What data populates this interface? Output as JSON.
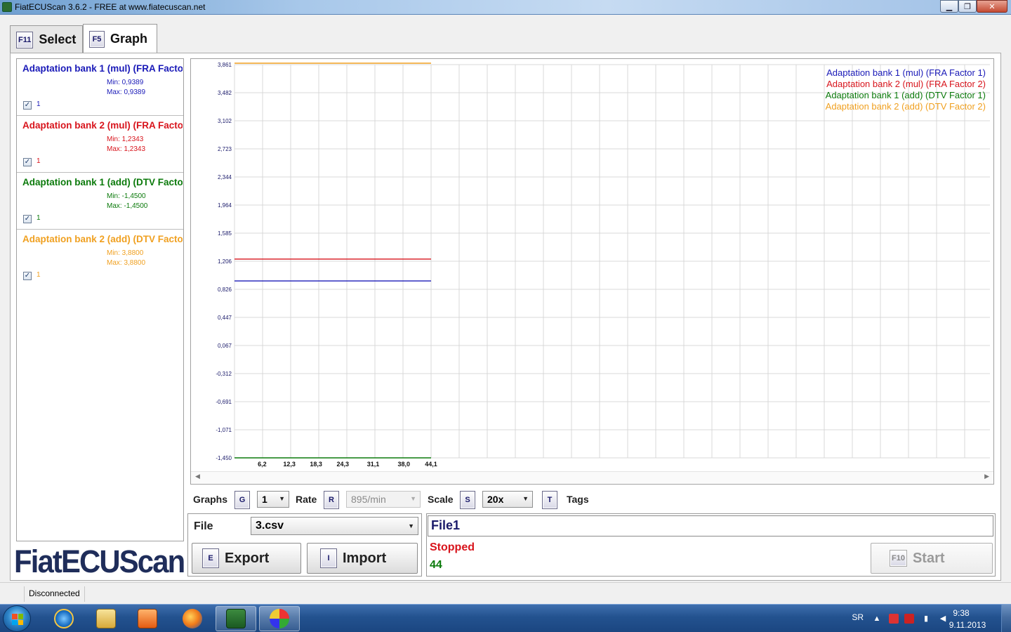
{
  "window": {
    "title": "FiatECUScan 3.6.2 - FREE at www.fiatecuscan.net",
    "minimize": "▁",
    "maximize": "❐",
    "close": "✕"
  },
  "tabs": [
    {
      "key": "F11",
      "label": "Select",
      "active": false
    },
    {
      "key": "F5",
      "label": "Graph",
      "active": true
    }
  ],
  "sensors": [
    {
      "name": "Adaptation bank 1 (mul) (FRA Factor 1)",
      "min": "Min: 0,9389",
      "max": "Max: 0,9389",
      "check_label": "1",
      "checked": true,
      "color": "#1a1ab8"
    },
    {
      "name": "Adaptation bank 2 (mul) (FRA Factor 2)",
      "min": "Min: 1,2343",
      "max": "Max: 1,2343",
      "check_label": "1",
      "checked": true,
      "color": "#d8141c"
    },
    {
      "name": "Adaptation bank 1 (add) (DTV Factor 1)",
      "min": "Min: -1,4500",
      "max": "Max: -1,4500",
      "check_label": "1",
      "checked": true,
      "color": "#0b7a0b"
    },
    {
      "name": "Adaptation bank 2 (add) (DTV Factor 2)",
      "min": "Min: 3,8800",
      "max": "Max: 3,8800",
      "check_label": "1",
      "checked": true,
      "color": "#f0a020"
    }
  ],
  "logo": "FiatECUScan",
  "chart_data": {
    "type": "line",
    "y_ticks": [
      "3,861",
      "3,482",
      "3,102",
      "2,723",
      "2,344",
      "1,964",
      "1,585",
      "1,206",
      "0,826",
      "0,447",
      "0,067",
      "-0,312",
      "-0,691",
      "-1,071",
      "-1,450"
    ],
    "x_ticks": [
      "6,2",
      "12,3",
      "18,3",
      "24,3",
      "31,1",
      "38,0",
      "44,1"
    ],
    "ylim": [
      -1.45,
      3.861
    ],
    "xlim": [
      0,
      44.1
    ],
    "grid": true,
    "legend_position": "top-right",
    "series": [
      {
        "name": "Adaptation bank 1 (mul) (FRA Factor 1)",
        "color": "#1a1ab8",
        "x": [
          0,
          44.1
        ],
        "y": [
          0.9389,
          0.9389
        ]
      },
      {
        "name": "Adaptation bank 2 (mul) (FRA Factor 2)",
        "color": "#d8141c",
        "x": [
          0,
          44.1
        ],
        "y": [
          1.2343,
          1.2343
        ]
      },
      {
        "name": "Adaptation bank 1 (add) (DTV Factor 1)",
        "color": "#0b7a0b",
        "x": [
          0,
          44.1
        ],
        "y": [
          -1.45,
          -1.45
        ]
      },
      {
        "name": "Adaptation bank 2 (add) (DTV Factor 2)",
        "color": "#f0a020",
        "x": [
          0,
          44.1
        ],
        "y": [
          3.88,
          3.88
        ]
      }
    ]
  },
  "controls": {
    "graphs_label": "Graphs",
    "graphs_key": "G",
    "graphs_value": "1",
    "rate_label": "Rate",
    "rate_key": "R",
    "rate_value": "895/min",
    "scale_label": "Scale",
    "scale_key": "S",
    "scale_value": "20x",
    "tags_key": "T",
    "tags_label": "Tags",
    "dropdown_arrow": "▼"
  },
  "file": {
    "label": "File",
    "value": "3.csv",
    "export_key": "E",
    "export_label": "Export",
    "import_key": "I",
    "import_label": "Import"
  },
  "status": {
    "file_name": "File1",
    "state": "Stopped",
    "count": "44",
    "start_key": "F10",
    "start_label": "Start"
  },
  "statusbar": {
    "connection": "Disconnected"
  },
  "taskbar": {
    "apps": [
      "internet-explorer",
      "file-explorer",
      "media-player",
      "firefox",
      "fiatecuscan",
      "paint"
    ],
    "language": "SR",
    "time": "9:38",
    "date": "9.11.2013"
  },
  "colors": {
    "series1": "#1a1ab8",
    "series2": "#d8141c",
    "series3": "#0b7a0b",
    "series4": "#f0a020",
    "stopped": "#d8141c",
    "count": "#0b7a0b"
  }
}
